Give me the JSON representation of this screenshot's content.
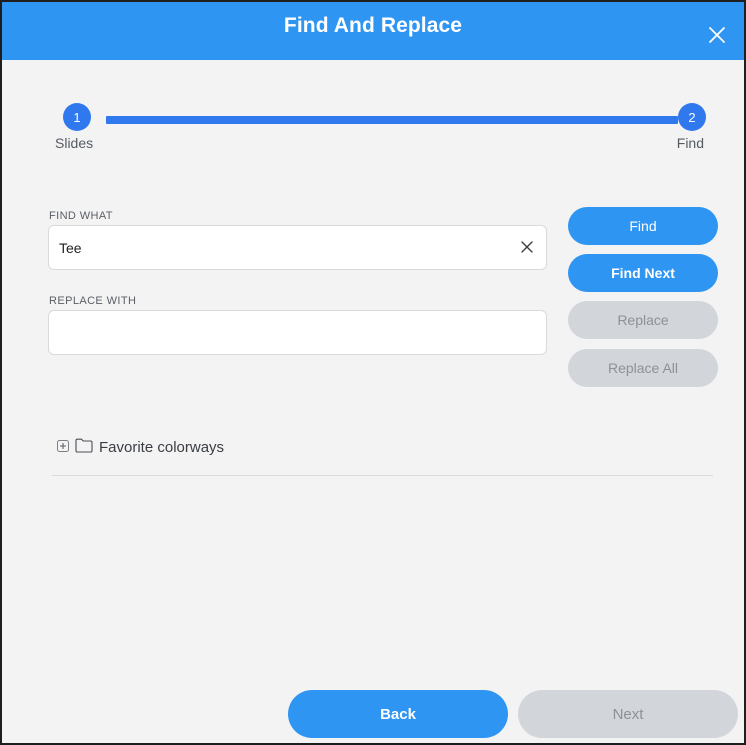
{
  "dialog": {
    "title": "Find And Replace",
    "close_icon": "close-icon"
  },
  "stepper": {
    "steps": [
      {
        "number": "1",
        "label": "Slides"
      },
      {
        "number": "2",
        "label": "Find"
      }
    ]
  },
  "find": {
    "label": "FIND WHAT",
    "value": "Tee",
    "placeholder": ""
  },
  "replace": {
    "label": "REPLACE WITH",
    "value": "",
    "placeholder": ""
  },
  "actions": {
    "find": "Find",
    "find_next": "Find Next",
    "replace": "Replace",
    "replace_all": "Replace All"
  },
  "tree": {
    "items": [
      {
        "label": "Favorite colorways",
        "expand_icon": "plus-square-icon",
        "folder_icon": "folder-icon"
      }
    ]
  },
  "footer": {
    "back": "Back",
    "next": "Next"
  },
  "colors": {
    "accent": "#2f95f2",
    "step": "#2f78ee",
    "disabled": "#d2d5da",
    "background": "#f3f3f4"
  }
}
